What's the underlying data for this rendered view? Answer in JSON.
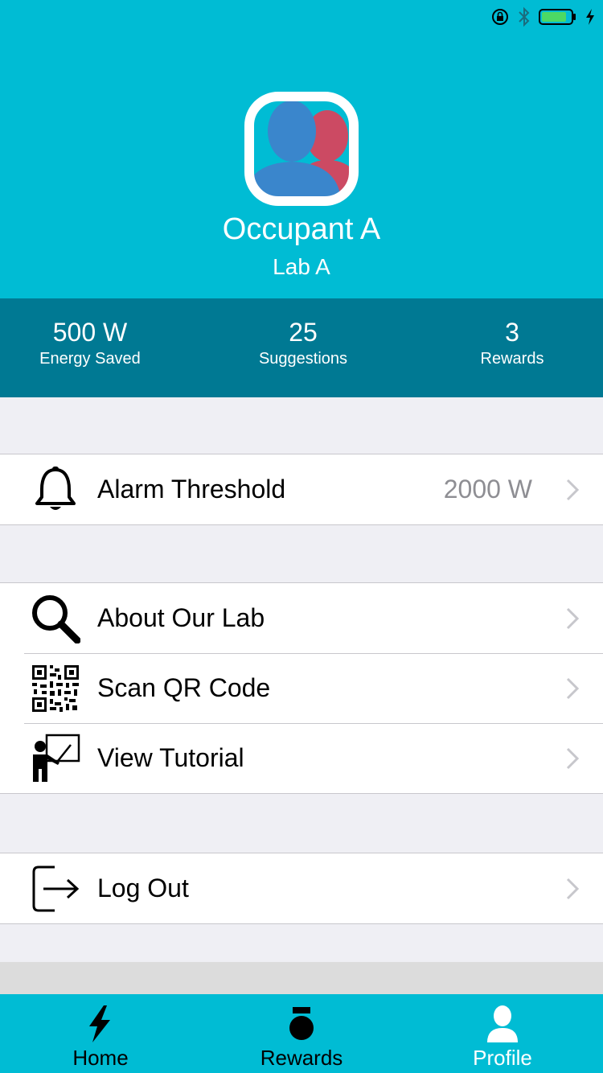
{
  "profile": {
    "name": "Occupant A",
    "lab": "Lab A"
  },
  "stats": [
    {
      "value": "500 W",
      "label": "Energy Saved"
    },
    {
      "value": "25",
      "label": "Suggestions"
    },
    {
      "value": "3",
      "label": "Rewards"
    }
  ],
  "settings": {
    "alarm": {
      "label": "Alarm Threshold",
      "value": "2000 W",
      "icon": "bell-icon"
    },
    "about": {
      "label": "About Our Lab",
      "icon": "magnifier-icon"
    },
    "scan": {
      "label": "Scan QR Code",
      "icon": "qr-code-icon"
    },
    "tutorial": {
      "label": "View Tutorial",
      "icon": "teacher-icon"
    },
    "logout": {
      "label": "Log Out",
      "icon": "logout-icon"
    }
  },
  "tabs": [
    {
      "label": "Home",
      "icon": "lightning-icon",
      "active": false
    },
    {
      "label": "Rewards",
      "icon": "medal-icon",
      "active": false
    },
    {
      "label": "Profile",
      "icon": "person-icon",
      "active": true
    }
  ],
  "colors": {
    "primary": "#00bcd4",
    "stats_bg": "#007993",
    "background": "#efeff4",
    "avatar_male": "#3a86cc",
    "avatar_female": "#cc4a63",
    "battery": "#4cd964"
  }
}
